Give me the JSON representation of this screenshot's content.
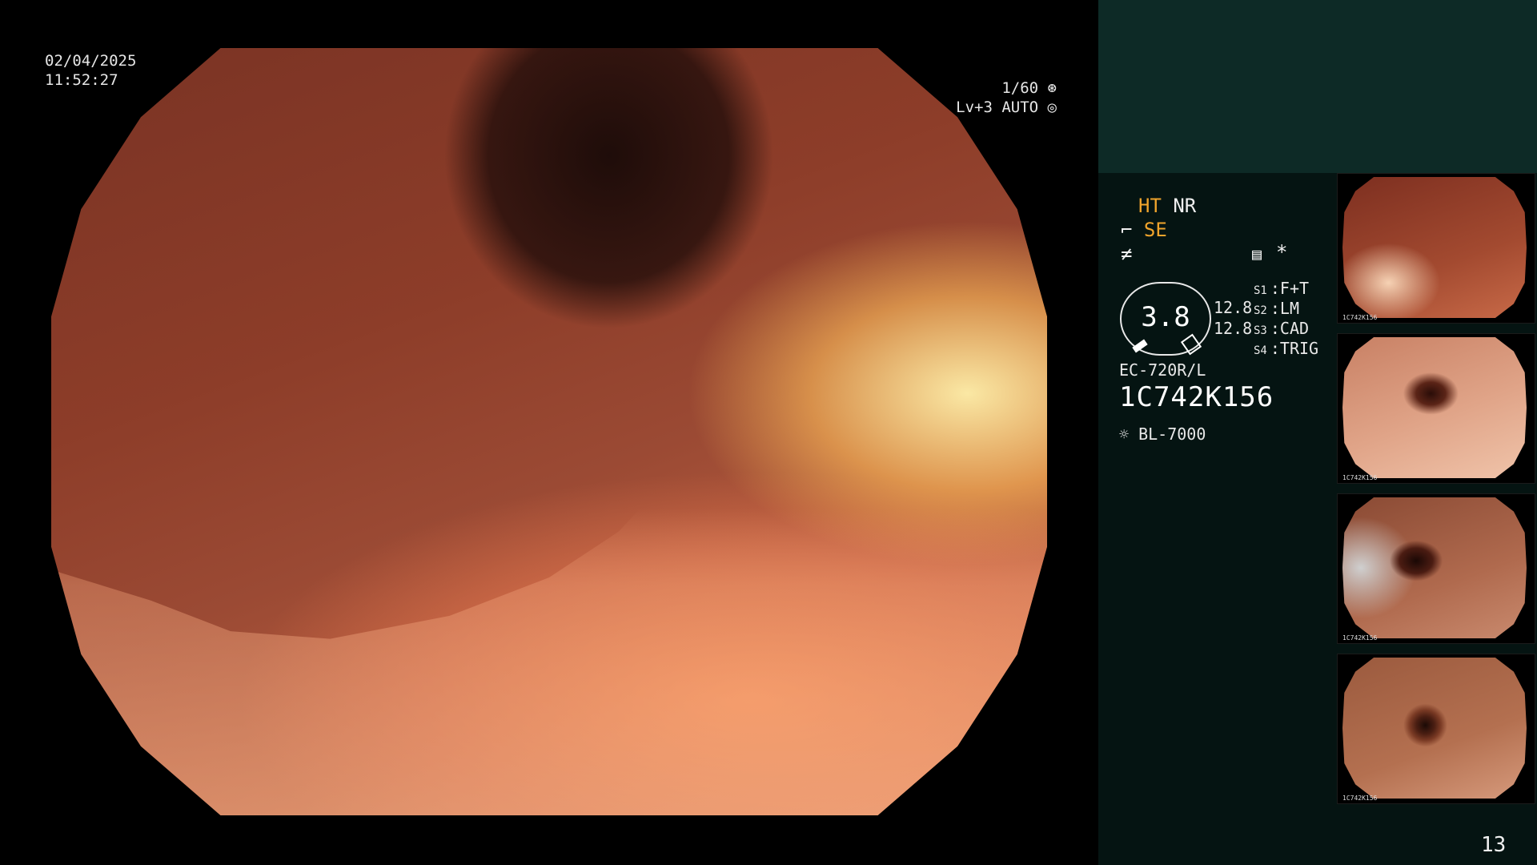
{
  "overlay": {
    "date": "02/04/2025",
    "time": "11:52:27",
    "shutter": "1/60",
    "brightness": "Lv+3 AUTO"
  },
  "panel": {
    "ht": "HT",
    "nr": "NR",
    "se": "SE",
    "asterisk": "*",
    "gauge_value": "3.8",
    "gauge_num_top": "12.8",
    "gauge_num_bottom": "12.8",
    "slots": [
      {
        "key": "S1",
        "value": "F+T"
      },
      {
        "key": "S2",
        "value": "LM"
      },
      {
        "key": "S3",
        "value": "CAD"
      },
      {
        "key": "S4",
        "value": "TRIG"
      }
    ],
    "scope_model": "EC-720R/L",
    "scope_serial": "1C742K156",
    "light_source": "BL-7000"
  },
  "thumbnails": [
    {
      "label": "1C742K156"
    },
    {
      "label": "1C742K156"
    },
    {
      "label": "1C742K156"
    },
    {
      "label": "1C742K156"
    }
  ],
  "page_number": "13",
  "colors": {
    "accent": "#f0a42c",
    "panel_top": "#0d2a26",
    "panel_body": "#051412"
  }
}
